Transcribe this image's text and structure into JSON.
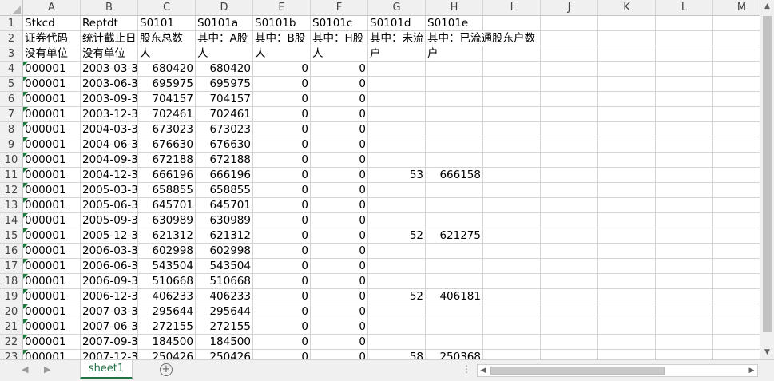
{
  "columns": [
    "A",
    "B",
    "C",
    "D",
    "E",
    "F",
    "G",
    "H",
    "I",
    "J",
    "K",
    "L",
    "M"
  ],
  "row_numbers": [
    "1",
    "2",
    "3",
    "4",
    "5",
    "6",
    "7",
    "8",
    "9",
    "10",
    "11",
    "12",
    "13",
    "14",
    "15",
    "16",
    "17",
    "18",
    "19",
    "20",
    "21",
    "22",
    "23"
  ],
  "rows": [
    [
      "Stkcd",
      "Reptdt",
      "S0101",
      "S0101a",
      "S0101b",
      "S0101c",
      "S0101d",
      "S0101e"
    ],
    [
      "证券代码",
      "统计截止日",
      "股东总数",
      "其中：A股",
      "其中：B股",
      "其中：H股",
      "其中：未流",
      "其中：已流通股东户数"
    ],
    [
      "没有单位",
      "没有单位",
      "人",
      "人",
      "人",
      "人",
      "户",
      "户"
    ],
    [
      "000001",
      "2003-03-3",
      "680420",
      "680420",
      "0",
      "0",
      "",
      ""
    ],
    [
      "000001",
      "2003-06-3",
      "695975",
      "695975",
      "0",
      "0",
      "",
      ""
    ],
    [
      "000001",
      "2003-09-3",
      "704157",
      "704157",
      "0",
      "0",
      "",
      ""
    ],
    [
      "000001",
      "2003-12-3",
      "702461",
      "702461",
      "0",
      "0",
      "",
      ""
    ],
    [
      "000001",
      "2004-03-3",
      "673023",
      "673023",
      "0",
      "0",
      "",
      ""
    ],
    [
      "000001",
      "2004-06-3",
      "676630",
      "676630",
      "0",
      "0",
      "",
      ""
    ],
    [
      "000001",
      "2004-09-3",
      "672188",
      "672188",
      "0",
      "0",
      "",
      ""
    ],
    [
      "000001",
      "2004-12-3",
      "666196",
      "666196",
      "0",
      "0",
      "53",
      "666158"
    ],
    [
      "000001",
      "2005-03-3",
      "658855",
      "658855",
      "0",
      "0",
      "",
      ""
    ],
    [
      "000001",
      "2005-06-3",
      "645701",
      "645701",
      "0",
      "0",
      "",
      ""
    ],
    [
      "000001",
      "2005-09-3",
      "630989",
      "630989",
      "0",
      "0",
      "",
      ""
    ],
    [
      "000001",
      "2005-12-3",
      "621312",
      "621312",
      "0",
      "0",
      "52",
      "621275"
    ],
    [
      "000001",
      "2006-03-3",
      "602998",
      "602998",
      "0",
      "0",
      "",
      ""
    ],
    [
      "000001",
      "2006-06-3",
      "543504",
      "543504",
      "0",
      "0",
      "",
      ""
    ],
    [
      "000001",
      "2006-09-3",
      "510668",
      "510668",
      "0",
      "0",
      "",
      ""
    ],
    [
      "000001",
      "2006-12-3",
      "406233",
      "406233",
      "0",
      "0",
      "52",
      "406181"
    ],
    [
      "000001",
      "2007-03-3",
      "295644",
      "295644",
      "0",
      "0",
      "",
      ""
    ],
    [
      "000001",
      "2007-06-3",
      "272155",
      "272155",
      "0",
      "0",
      "",
      ""
    ],
    [
      "000001",
      "2007-09-3",
      "184500",
      "184500",
      "0",
      "0",
      "",
      ""
    ],
    [
      "000001",
      "2007-12-3",
      "250426",
      "250426",
      "0",
      "0",
      "58",
      "250368"
    ]
  ],
  "sheet_tab": "sheet1",
  "icons": {
    "add_sheet": "plus-circle-icon",
    "scroll_up": "triangle-up-icon",
    "scroll_down": "triangle-down-icon",
    "scroll_left": "triangle-left-icon",
    "scroll_right": "triangle-right-icon",
    "sheet_prev": "chevron-left-icon",
    "sheet_next": "chevron-right-icon"
  },
  "colors": {
    "accent": "#217346",
    "text_flag": "#1e7a3c",
    "header_bg": "#f0f0f0",
    "gridline": "#d4d4d4"
  }
}
